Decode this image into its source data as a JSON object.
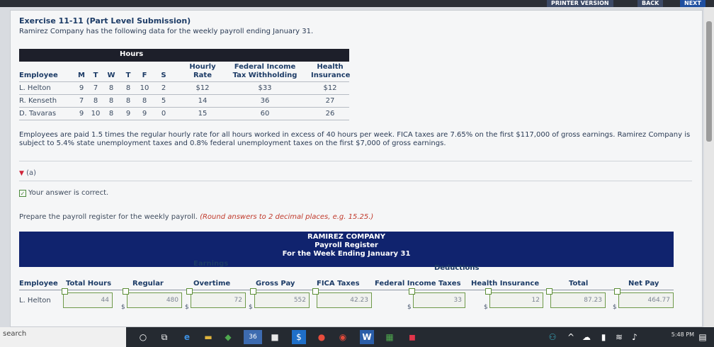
{
  "top_nav": {
    "printer": "PRINTER VERSION",
    "back": "BACK",
    "next": "NEXT"
  },
  "exercise": {
    "title": "Exercise 11-11 (Part Level Submission)",
    "subtitle": "Ramirez Company has the following data for the weekly payroll ending January 31."
  },
  "hours_table": {
    "group_label": "Hours",
    "headers": {
      "employee": "Employee",
      "m": "M",
      "t": "T",
      "w": "W",
      "th": "T",
      "f": "F",
      "s": "S",
      "rate_1": "Hourly",
      "rate_2": "Rate",
      "fed_1": "Federal Income",
      "fed_2": "Tax Withholding",
      "health_1": "Health",
      "health_2": "Insurance"
    },
    "rows": [
      {
        "employee": "L. Helton",
        "m": "9",
        "t": "7",
        "w": "8",
        "th": "8",
        "f": "10",
        "s": "2",
        "rate": "$12",
        "fed": "$33",
        "health": "$12"
      },
      {
        "employee": "R. Kenseth",
        "m": "7",
        "t": "8",
        "w": "8",
        "th": "8",
        "f": "8",
        "s": "5",
        "rate": "14",
        "fed": "36",
        "health": "27"
      },
      {
        "employee": "D. Tavaras",
        "m": "9",
        "t": "10",
        "w": "8",
        "th": "9",
        "f": "9",
        "s": "0",
        "rate": "15",
        "fed": "60",
        "health": "26"
      }
    ]
  },
  "paragraph": "Employees are paid 1.5 times the regular hourly rate for all hours worked in excess of 40 hours per week. FICA taxes are 7.65% on the first $117,000 of gross earnings. Ramirez Company is subject to 5.4% state unemployment taxes and 0.8% federal unemployment taxes on the first $7,000 of gross earnings.",
  "part": {
    "label": "(a)",
    "status": "Your answer is correct."
  },
  "prompt": {
    "text": "Prepare the payroll register for the weekly payroll. ",
    "hint": "(Round answers to 2 decimal places, e.g. 15.25.)"
  },
  "register": {
    "line1": "RAMIREZ COMPANY",
    "line2": "Payroll Register",
    "line3": "For the Week Ending January 31",
    "earnings": "Earnings",
    "deductions": "Deductions",
    "columns": {
      "employee": "Employee",
      "total_hours": "Total Hours",
      "regular": "Regular",
      "overtime": "Overtime",
      "gross": "Gross Pay",
      "fica": "FICA Taxes",
      "fed": "Federal Income Taxes",
      "health": "Health Insurance",
      "total": "Total",
      "net": "Net Pay"
    },
    "row": {
      "employee": "L. Helton",
      "total_hours": "44",
      "regular": "480",
      "overtime": "72",
      "gross": "552",
      "fica": "42.23",
      "fed": "33",
      "health": "12",
      "total": "87.23",
      "net": "464.77",
      "dollar": "$"
    }
  },
  "taskbar": {
    "search": "search",
    "badge": "36",
    "time": "5:48 PM"
  }
}
